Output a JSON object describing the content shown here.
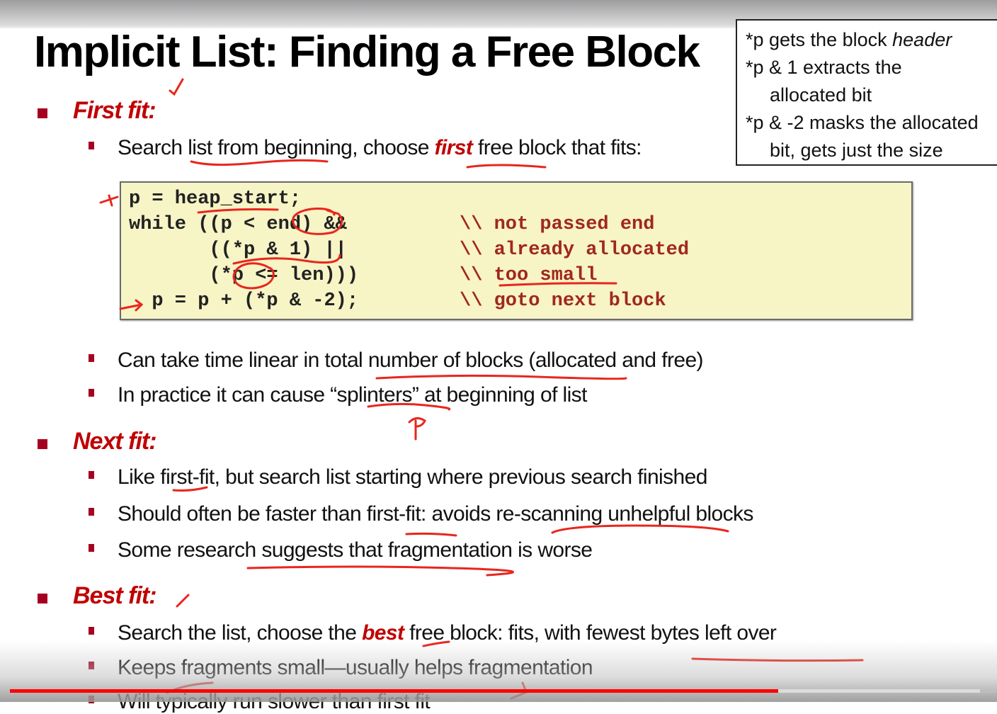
{
  "slide": {
    "title": "Implicit List: Finding a Free Block",
    "callout": {
      "lines": [
        {
          "text": "*p gets the block ",
          "em": "header"
        },
        {
          "text": "*p & 1 extracts the"
        },
        {
          "text": "allocated bit",
          "indent": true
        },
        {
          "text": "*p & -2 masks the allocated"
        },
        {
          "text": "bit, gets just the size",
          "indent": true
        }
      ]
    },
    "sections": [
      {
        "heading": "First fit:",
        "items": [
          {
            "before": "Search list from beginning, choose ",
            "emph": "first",
            "after": " free block that fits:"
          },
          {
            "text": "Can take time linear in total number of blocks (allocated and free)"
          },
          {
            "text": "In practice it can cause “splinters” at beginning of list"
          }
        ]
      },
      {
        "heading": "Next fit:",
        "items": [
          {
            "text": "Like first-fit, but search list starting where previous search finished"
          },
          {
            "text": "Should often be faster than first-fit: avoids re-scanning unhelpful blocks"
          },
          {
            "text": "Some research suggests that fragmentation is worse"
          }
        ]
      },
      {
        "heading": "Best fit:",
        "items": [
          {
            "before": "Search the list, choose the ",
            "emph": "best",
            "after": " free block: fits, with fewest bytes left over"
          },
          {
            "text": "Keeps fragments small—usually helps fragmentation"
          },
          {
            "text": "Will typically run slower than first fit"
          }
        ]
      }
    ],
    "code": {
      "lines": [
        "p = heap_start;",
        "while ((p < end) &&",
        "       ((*p & 1) ||",
        "       (*p <= len)))",
        "  p = p + (*p & -2);"
      ],
      "comments": [
        "",
        "\\\\ not passed end",
        "\\\\ already allocated",
        "\\\\ too small",
        "\\\\ goto next block"
      ]
    }
  },
  "player": {
    "progress_fraction": 0.778,
    "buffered_fraction": 0.983,
    "progress_color": "#ff0000"
  },
  "colors": {
    "heading": "#c00000",
    "bullet": "#a50021",
    "code_bg": "#f7f4c6",
    "code_comment": "#a0281e",
    "annotation_ink": "#e8261e"
  }
}
